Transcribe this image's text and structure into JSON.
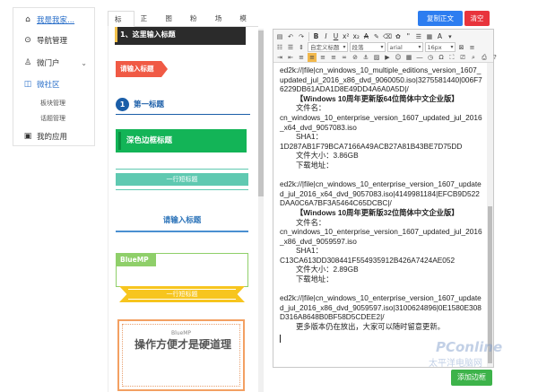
{
  "sidebar": {
    "items": [
      {
        "label": "我是我家...",
        "icon": "home-icon"
      },
      {
        "label": "导航管理",
        "icon": "compass-icon"
      },
      {
        "label": "微门户",
        "icon": "user-icon"
      },
      {
        "label": "微社区",
        "icon": "chat-icon"
      },
      {
        "label": "我的应用",
        "icon": "grid-icon"
      }
    ],
    "subitems": [
      "板块管理",
      "话题管理"
    ]
  },
  "tabs": [
    "标题",
    "正文",
    "图片",
    "粉粒",
    "场景",
    "模板"
  ],
  "buttons": {
    "copy": "复制正文",
    "clear": "清空",
    "add": "添加边框"
  },
  "gallery": {
    "g1": "1、这里输入标题",
    "g2": "请输入标题",
    "g3_num": "1",
    "g3": "第一标题",
    "g4": "深色边框标题",
    "g5": "一行短标题",
    "g6": "请输入标题",
    "g7": "BlueMP",
    "g8": "一行短标题",
    "g9_small": "BlueMP",
    "g9_big": "操作方便才是硬道理"
  },
  "toolbar": {
    "row1": [
      "B",
      "I",
      "U",
      "x²",
      "x₂",
      "A",
      "\"",
      "A"
    ],
    "para_format": "段落",
    "custom_title": "自定义标题",
    "font_family": "arial",
    "font_size": "16px"
  },
  "editor": {
    "lines": [
      {
        "t": "ed2k://|file|cn_windows_10_multiple_editions_version_1607_updated_jul_2016_x86_dvd_9060050.iso|3275581440|006F76229DB61ADA1D8E49DD4A6A0A5D|/",
        "c": ""
      },
      {
        "t": "【Windows 10周年更新版64位简体中文企业版】",
        "c": "hd"
      },
      {
        "t": "文件名：",
        "c": "ind"
      },
      {
        "t": "cn_windows_10_enterprise_version_1607_updated_jul_2016_x64_dvd_9057083.iso",
        "c": ""
      },
      {
        "t": "SHA1：",
        "c": "ind"
      },
      {
        "t": "1D287AB1F79BCA7166A49ACB27A81B43BE7D75DD",
        "c": ""
      },
      {
        "t": "文件大小：3.86GB",
        "c": "ind"
      },
      {
        "t": "下载地址：",
        "c": "ind"
      },
      {
        "t": "",
        "c": "gap"
      },
      {
        "t": "ed2k://|file|cn_windows_10_enterprise_version_1607_updated_jul_2016_x64_dvd_9057083.iso|4149981184|EFCB9D522DAA0C6A7BF3A5464C65DCBC|/",
        "c": ""
      },
      {
        "t": "【Windows 10周年更新版32位简体中文企业版】",
        "c": "hd"
      },
      {
        "t": "文件名：",
        "c": "ind"
      },
      {
        "t": "cn_windows_10_enterprise_version_1607_updated_jul_2016_x86_dvd_9059597.iso",
        "c": ""
      },
      {
        "t": "SHA1：",
        "c": "ind"
      },
      {
        "t": "C13CA613DD308441F554935912B426A7424AE052",
        "c": ""
      },
      {
        "t": "文件大小：2.89GB",
        "c": "ind"
      },
      {
        "t": "下载地址：",
        "c": "ind"
      },
      {
        "t": "",
        "c": "gap"
      },
      {
        "t": "ed2k://|file|cn_windows_10_enterprise_version_1607_updated_jul_2016_x86_dvd_9059597.iso|3100624896|0E1580E308D316A8648B0BF58D5CDEE2|/",
        "c": ""
      },
      {
        "t": "更多版本仍在放出，大家可以随时留意更新。",
        "c": "ind"
      }
    ]
  },
  "watermark": {
    "brand": "PConline",
    "sub": "太平洋电脑网"
  }
}
